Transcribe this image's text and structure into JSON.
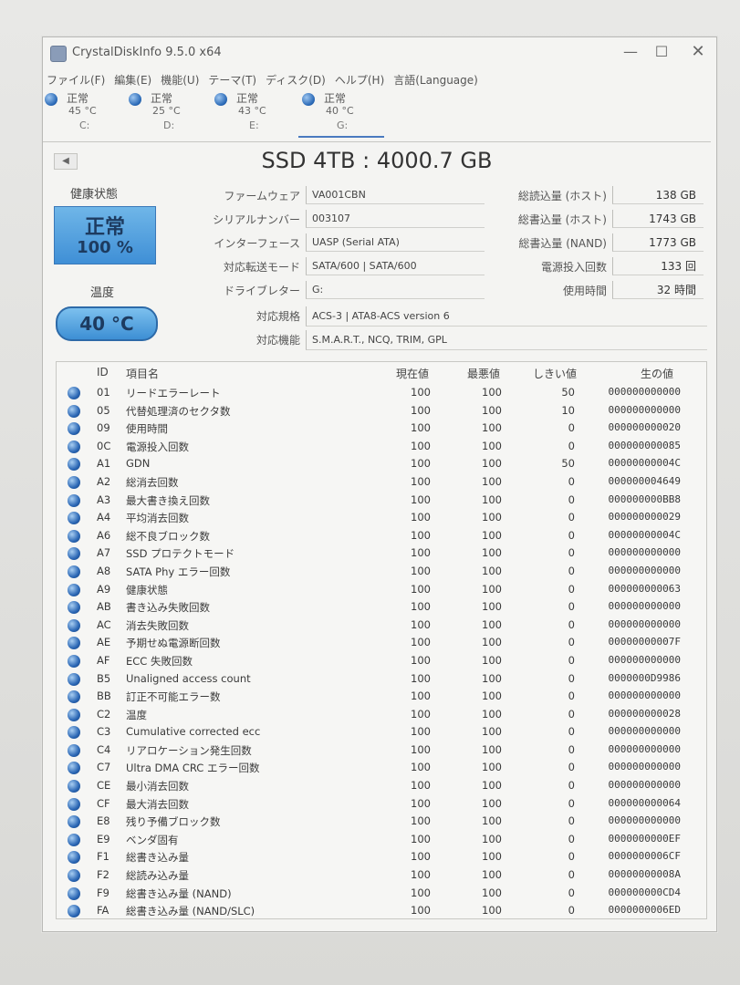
{
  "window": {
    "title": "CrystalDiskInfo 9.5.0 x64",
    "controls": {
      "minimize": "—",
      "maximize": "☐",
      "close": "✕"
    }
  },
  "menu": [
    "ファイル(F)",
    "編集(E)",
    "機能(U)",
    "テーマ(T)",
    "ディスク(D)",
    "ヘルプ(H)",
    "言語(Language)"
  ],
  "drives": [
    {
      "status": "正常",
      "temp": "45 °C",
      "letter": "C:"
    },
    {
      "status": "正常",
      "temp": "25 °C",
      "letter": "D:"
    },
    {
      "status": "正常",
      "temp": "43 °C",
      "letter": "E:"
    },
    {
      "status": "正常",
      "temp": "40 °C",
      "letter": "G:"
    }
  ],
  "disk": {
    "title": "SSD 4TB : 4000.7 GB",
    "health_label": "健康状態",
    "health_status": "正常",
    "health_percent": "100 %",
    "temp_label": "温度",
    "temp": "40 °C",
    "firmware_label": "ファームウェア",
    "firmware": "VA001CBN",
    "serial_label": "シリアルナンバー",
    "serial": "003107",
    "interface_label": "インターフェース",
    "interface": "UASP (Serial ATA)",
    "transfer_label": "対応転送モード",
    "transfer": "SATA/600 | SATA/600",
    "drive_letter_label": "ドライブレター",
    "drive_letter": "G:",
    "standard_label": "対応規格",
    "standard": "ACS-3 | ATA8-ACS version 6",
    "features_label": "対応機能",
    "features": "S.M.A.R.T., NCQ, TRIM, GPL",
    "host_reads_label": "総読込量 (ホスト)",
    "host_reads": "138 GB",
    "host_writes_label": "総書込量 (ホスト)",
    "host_writes": "1743 GB",
    "nand_writes_label": "総書込量 (NAND)",
    "nand_writes": "1773 GB",
    "power_count_label": "電源投入回数",
    "power_count": "133 回",
    "power_hours_label": "使用時間",
    "power_hours": "32 時間"
  },
  "smart_headers": {
    "id": "ID",
    "name": "項目名",
    "current": "現在値",
    "worst": "最悪値",
    "threshold": "しきい値",
    "raw": "生の値"
  },
  "smart": [
    {
      "id": "01",
      "name": "リードエラーレート",
      "cur": "100",
      "worst": "100",
      "thr": "50",
      "raw": "000000000000"
    },
    {
      "id": "05",
      "name": "代替処理済のセクタ数",
      "cur": "100",
      "worst": "100",
      "thr": "10",
      "raw": "000000000000"
    },
    {
      "id": "09",
      "name": "使用時間",
      "cur": "100",
      "worst": "100",
      "thr": "0",
      "raw": "000000000020"
    },
    {
      "id": "0C",
      "name": "電源投入回数",
      "cur": "100",
      "worst": "100",
      "thr": "0",
      "raw": "000000000085"
    },
    {
      "id": "A1",
      "name": "GDN",
      "cur": "100",
      "worst": "100",
      "thr": "50",
      "raw": "00000000004C"
    },
    {
      "id": "A2",
      "name": "総消去回数",
      "cur": "100",
      "worst": "100",
      "thr": "0",
      "raw": "000000004649"
    },
    {
      "id": "A3",
      "name": "最大書き換え回数",
      "cur": "100",
      "worst": "100",
      "thr": "0",
      "raw": "000000000BB8"
    },
    {
      "id": "A4",
      "name": "平均消去回数",
      "cur": "100",
      "worst": "100",
      "thr": "0",
      "raw": "000000000029"
    },
    {
      "id": "A6",
      "name": "総不良ブロック数",
      "cur": "100",
      "worst": "100",
      "thr": "0",
      "raw": "00000000004C"
    },
    {
      "id": "A7",
      "name": "SSD プロテクトモード",
      "cur": "100",
      "worst": "100",
      "thr": "0",
      "raw": "000000000000"
    },
    {
      "id": "A8",
      "name": "SATA Phy エラー回数",
      "cur": "100",
      "worst": "100",
      "thr": "0",
      "raw": "000000000000"
    },
    {
      "id": "A9",
      "name": "健康状態",
      "cur": "100",
      "worst": "100",
      "thr": "0",
      "raw": "000000000063"
    },
    {
      "id": "AB",
      "name": "書き込み失敗回数",
      "cur": "100",
      "worst": "100",
      "thr": "0",
      "raw": "000000000000"
    },
    {
      "id": "AC",
      "name": "消去失敗回数",
      "cur": "100",
      "worst": "100",
      "thr": "0",
      "raw": "000000000000"
    },
    {
      "id": "AE",
      "name": "予期せぬ電源断回数",
      "cur": "100",
      "worst": "100",
      "thr": "0",
      "raw": "00000000007F"
    },
    {
      "id": "AF",
      "name": "ECC 失敗回数",
      "cur": "100",
      "worst": "100",
      "thr": "0",
      "raw": "000000000000"
    },
    {
      "id": "B5",
      "name": "Unaligned access count",
      "cur": "100",
      "worst": "100",
      "thr": "0",
      "raw": "0000000D9986"
    },
    {
      "id": "BB",
      "name": "訂正不可能エラー数",
      "cur": "100",
      "worst": "100",
      "thr": "0",
      "raw": "000000000000"
    },
    {
      "id": "C2",
      "name": "温度",
      "cur": "100",
      "worst": "100",
      "thr": "0",
      "raw": "000000000028"
    },
    {
      "id": "C3",
      "name": "Cumulative corrected ecc",
      "cur": "100",
      "worst": "100",
      "thr": "0",
      "raw": "000000000000"
    },
    {
      "id": "C4",
      "name": "リアロケーション発生回数",
      "cur": "100",
      "worst": "100",
      "thr": "0",
      "raw": "000000000000"
    },
    {
      "id": "C7",
      "name": "Ultra DMA CRC エラー回数",
      "cur": "100",
      "worst": "100",
      "thr": "0",
      "raw": "000000000000"
    },
    {
      "id": "CE",
      "name": "最小消去回数",
      "cur": "100",
      "worst": "100",
      "thr": "0",
      "raw": "000000000000"
    },
    {
      "id": "CF",
      "name": "最大消去回数",
      "cur": "100",
      "worst": "100",
      "thr": "0",
      "raw": "000000000064"
    },
    {
      "id": "E8",
      "name": "残り予備ブロック数",
      "cur": "100",
      "worst": "100",
      "thr": "0",
      "raw": "000000000000"
    },
    {
      "id": "E9",
      "name": "ベンダ固有",
      "cur": "100",
      "worst": "100",
      "thr": "0",
      "raw": "0000000000EF"
    },
    {
      "id": "F1",
      "name": "総書き込み量",
      "cur": "100",
      "worst": "100",
      "thr": "0",
      "raw": "0000000006CF"
    },
    {
      "id": "F2",
      "name": "総読み込み量",
      "cur": "100",
      "worst": "100",
      "thr": "0",
      "raw": "00000000008A"
    },
    {
      "id": "F9",
      "name": "総書き込み量 (NAND)",
      "cur": "100",
      "worst": "100",
      "thr": "0",
      "raw": "000000000CD4"
    },
    {
      "id": "FA",
      "name": "総書き込み量 (NAND/SLC)",
      "cur": "100",
      "worst": "100",
      "thr": "0",
      "raw": "0000000006ED"
    }
  ]
}
